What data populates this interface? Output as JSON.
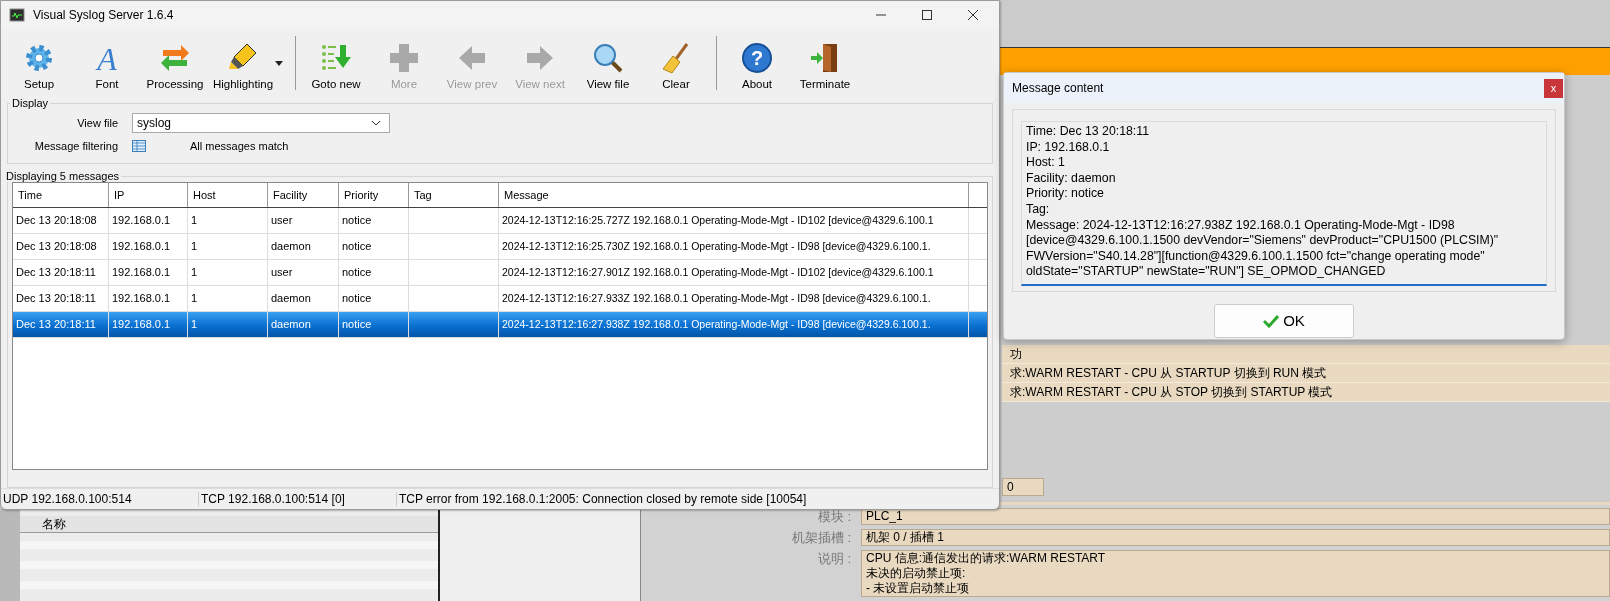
{
  "background_app": {
    "log_rows": [
      "功",
      "求:WARM RESTART  - CPU 从 STARTUP 切换到 RUN 模式",
      "求:WARM RESTART  - CPU 从 STOP 切换到 STARTUP 模式"
    ],
    "field_value": "0",
    "list_header": "名称",
    "properties": [
      {
        "label": "模块 :",
        "lines": [
          "PLC_1"
        ]
      },
      {
        "label": "机架插槽 :",
        "lines": [
          "机架 0 / 插槽 1"
        ]
      },
      {
        "label": "说明 :",
        "lines": [
          "CPU 信息:通信发出的请求:WARM RESTART",
          "未决的启动禁止项:",
          " - 未设置启动禁止项"
        ]
      }
    ]
  },
  "window": {
    "title": "Visual Syslog Server 1.6.4"
  },
  "toolbar": [
    {
      "kind": "button",
      "label": "Setup",
      "disabled": false
    },
    {
      "kind": "button",
      "label": "Font",
      "icon_text": "A",
      "disabled": false
    },
    {
      "kind": "button",
      "label": "Processing",
      "disabled": false
    },
    {
      "kind": "button",
      "label": "Highlighting",
      "disabled": false,
      "dropdown": true
    },
    {
      "kind": "separator"
    },
    {
      "kind": "button",
      "label": "Goto new",
      "disabled": false
    },
    {
      "kind": "button",
      "label": "More",
      "disabled": true
    },
    {
      "kind": "button",
      "label": "View prev",
      "disabled": true
    },
    {
      "kind": "button",
      "label": "View next",
      "disabled": true
    },
    {
      "kind": "button",
      "label": "View file",
      "disabled": false
    },
    {
      "kind": "button",
      "label": "Clear",
      "disabled": false
    },
    {
      "kind": "separator"
    },
    {
      "kind": "button",
      "label": "About",
      "icon_text": "?",
      "disabled": false
    },
    {
      "kind": "button",
      "label": "Terminate",
      "disabled": false
    }
  ],
  "display": {
    "title": "Display",
    "view_file_label": "View file",
    "view_file_value": "syslog",
    "filter_label": "Message filtering",
    "filter_status": "All messages match"
  },
  "messages": {
    "title": "Displaying 5 messages",
    "columns": [
      "Time",
      "IP",
      "Host",
      "Facility",
      "Priority",
      "Tag",
      "Message"
    ],
    "rows": [
      {
        "time": "Dec 13 20:18:08",
        "ip": "192.168.0.1",
        "host": "1",
        "facility": "user",
        "priority": "notice",
        "message": "2024-12-13T12:16:25.727Z 192.168.0.1 Operating-Mode-Mgt - ID102 [device@4329.6.100.1",
        "selected": false
      },
      {
        "time": "Dec 13 20:18:08",
        "ip": "192.168.0.1",
        "host": "1",
        "facility": "daemon",
        "priority": "notice",
        "message": "2024-12-13T12:16:25.730Z 192.168.0.1 Operating-Mode-Mgt - ID98 [device@4329.6.100.1.",
        "selected": false
      },
      {
        "time": "Dec 13 20:18:11",
        "ip": "192.168.0.1",
        "host": "1",
        "facility": "user",
        "priority": "notice",
        "message": "2024-12-13T12:16:27.901Z 192.168.0.1 Operating-Mode-Mgt - ID102 [device@4329.6.100.1",
        "selected": false
      },
      {
        "time": "Dec 13 20:18:11",
        "ip": "192.168.0.1",
        "host": "1",
        "facility": "daemon",
        "priority": "notice",
        "message": "2024-12-13T12:16:27.933Z 192.168.0.1 Operating-Mode-Mgt - ID98 [device@4329.6.100.1.",
        "selected": false
      },
      {
        "time": "Dec 13 20:18:11",
        "ip": "192.168.0.1",
        "host": "1",
        "facility": "daemon",
        "priority": "notice",
        "message": "2024-12-13T12:16:27.938Z 192.168.0.1 Operating-Mode-Mgt - ID98 [device@4329.6.100.1.",
        "selected": true
      }
    ]
  },
  "status_bar": [
    "UDP 192.168.0.100:514",
    "TCP 192.168.0.100:514 [0]",
    "TCP error from 192.168.0.1:2005: Connection closed by remote side [10054]"
  ],
  "dialog": {
    "title": "Message content",
    "close": "x",
    "lines": [
      "Time: Dec 13 20:18:11",
      "IP: 192.168.0.1",
      "Host: 1",
      "Facility: daemon",
      "Priority: notice",
      "Tag:",
      "Message: 2024-12-13T12:16:27.938Z 192.168.0.1 Operating-Mode-Mgt - ID98",
      "[device@4329.6.100.1.1500 devVendor=\"Siemens\" devProduct=\"CPU1500 (PLCSIM)\"",
      "FWVersion=\"S40.14.28\"][function@4329.6.100.1.1500 fct=\"change operating mode\"",
      "oldState=\"STARTUP\" newState=\"RUN\"] SE_OPMOD_CHANGED"
    ],
    "ok_label": "OK"
  }
}
